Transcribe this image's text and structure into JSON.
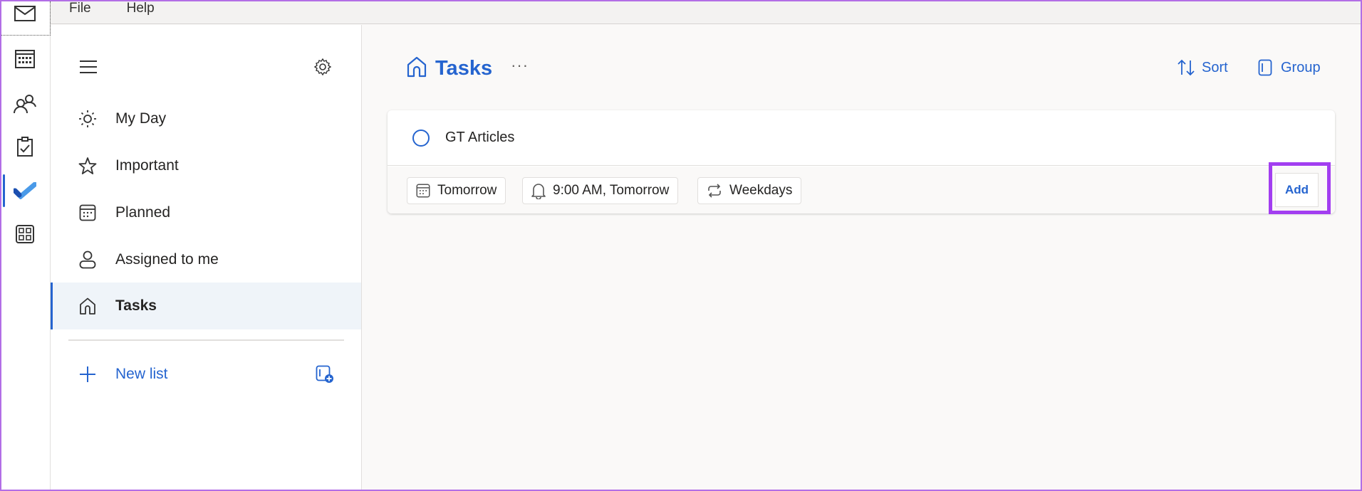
{
  "menu": {
    "file": "File",
    "help": "Help"
  },
  "rail": [
    "mail",
    "calendar",
    "people",
    "tasks-clipboard",
    "todo",
    "apps"
  ],
  "sidebar": {
    "items": [
      {
        "label": "My Day",
        "icon": "sun-icon"
      },
      {
        "label": "Important",
        "icon": "star-icon"
      },
      {
        "label": "Planned",
        "icon": "calendar-icon"
      },
      {
        "label": "Assigned to me",
        "icon": "person-icon"
      },
      {
        "label": "Tasks",
        "icon": "home-icon",
        "active": true
      }
    ],
    "new_list": "New list"
  },
  "header": {
    "title": "Tasks",
    "more": "···",
    "sort": "Sort",
    "group": "Group"
  },
  "task": {
    "title": "GT Articles",
    "due": "Tomorrow",
    "reminder": "9:00 AM, Tomorrow",
    "repeat": "Weekdays",
    "add": "Add"
  },
  "colors": {
    "accent": "#2564cf",
    "highlight": "#a23ef0"
  }
}
